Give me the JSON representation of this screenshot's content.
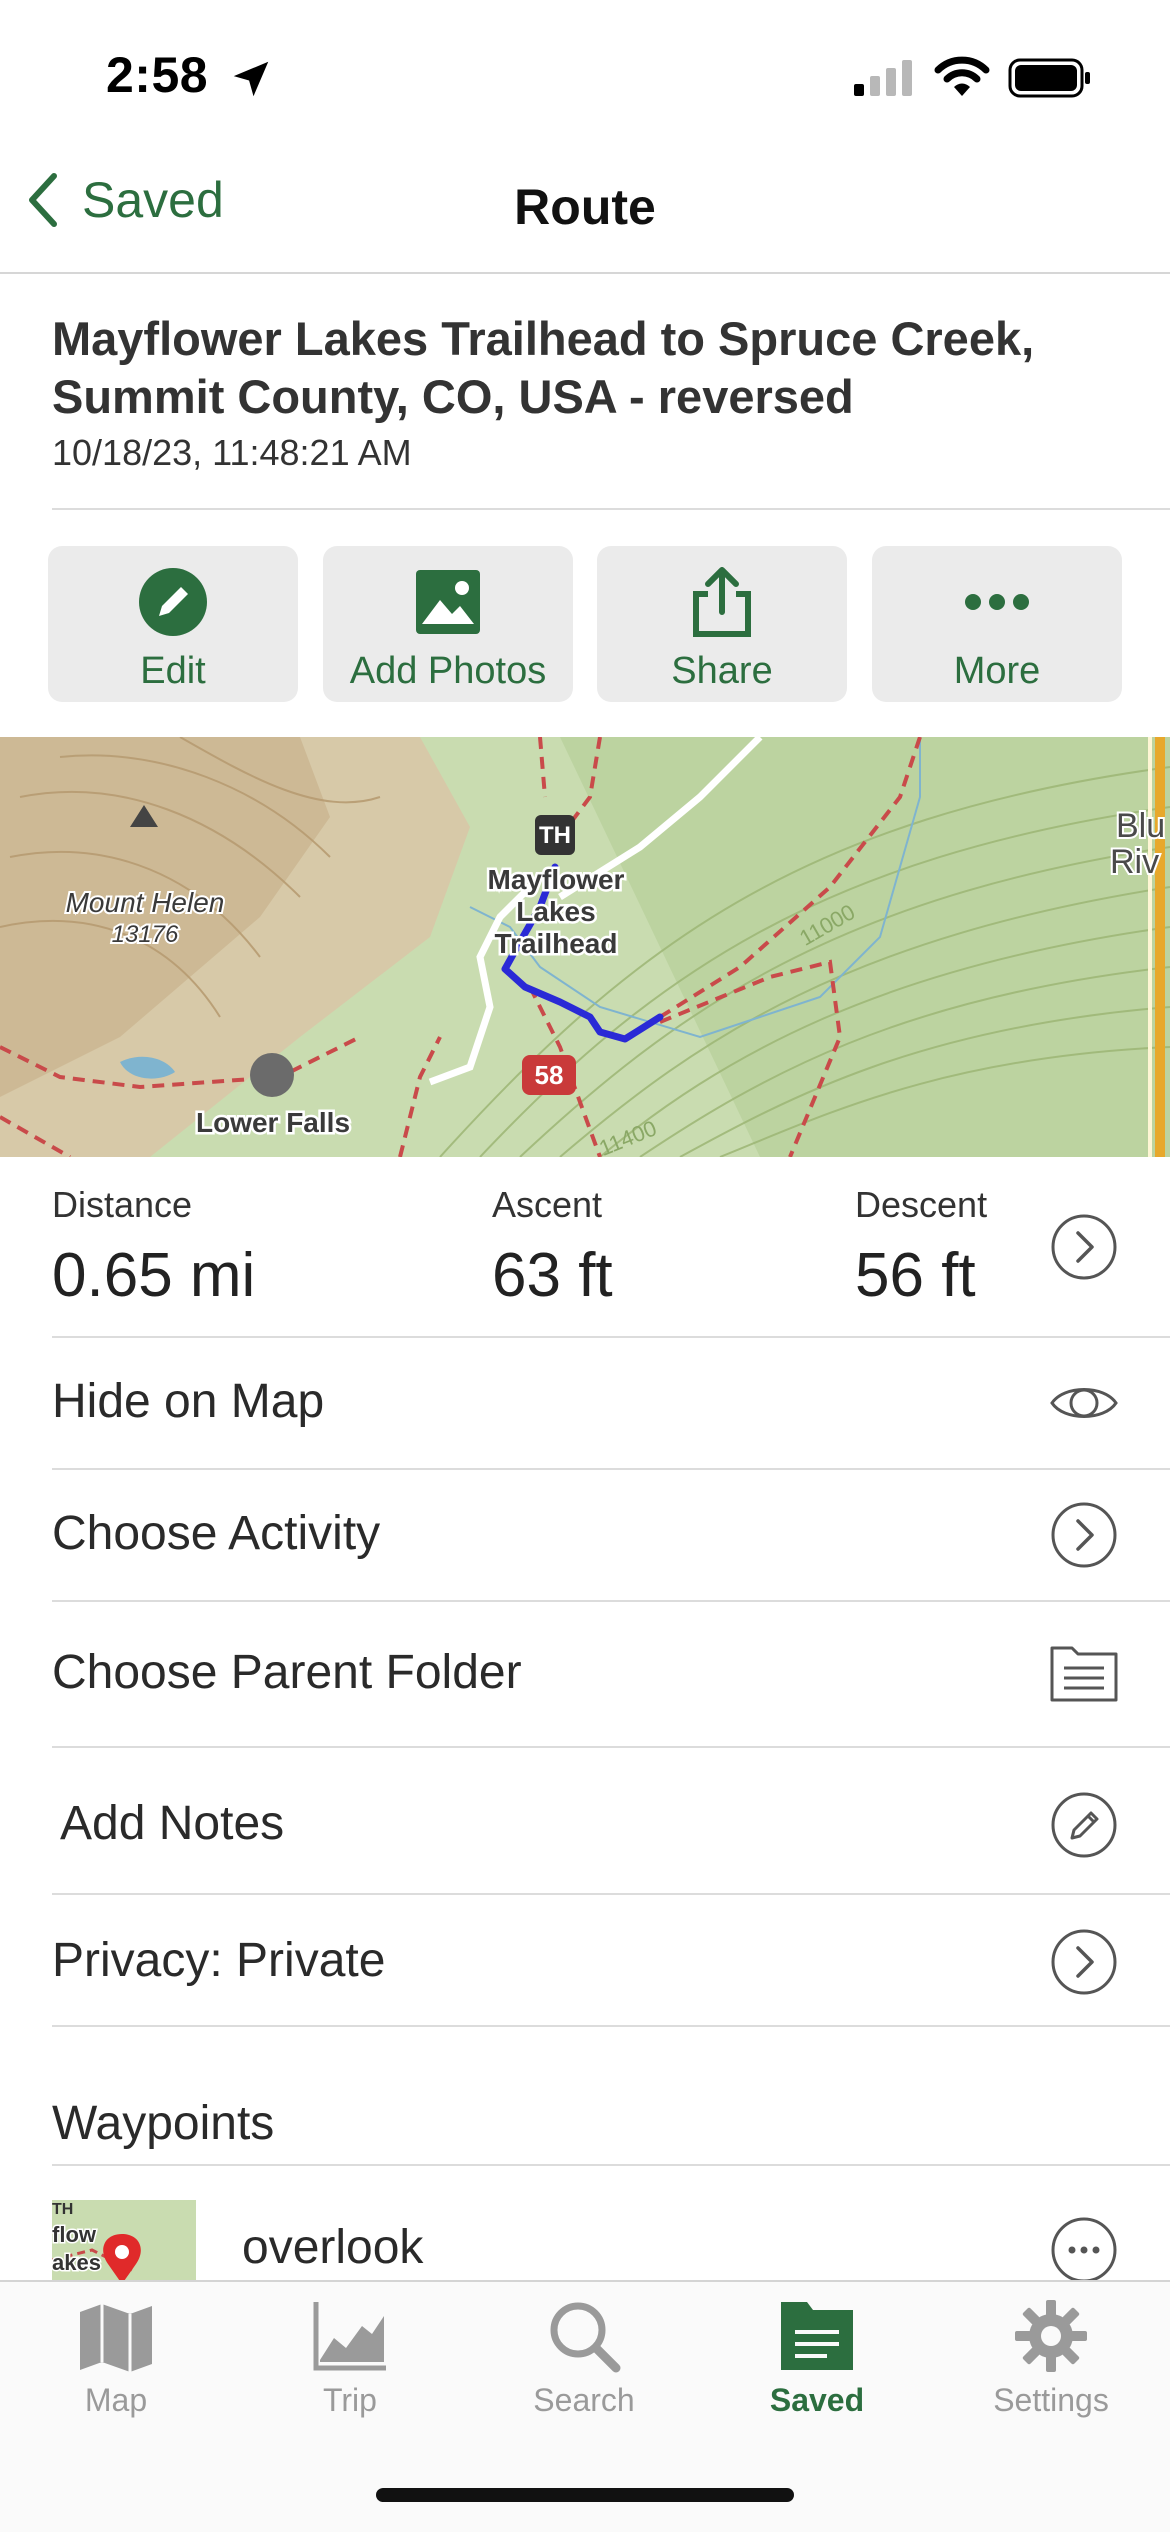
{
  "status_bar": {
    "time": "2:58"
  },
  "nav": {
    "back_label": "Saved",
    "title": "Route"
  },
  "route": {
    "title": "Mayflower Lakes Trailhead to Spruce Creek, Summit County, CO, USA - reversed",
    "date": "10/18/23, 11:48:21 AM"
  },
  "actions": [
    {
      "label": "Edit",
      "icon": "pencil-icon"
    },
    {
      "label": "Add Photos",
      "icon": "photo-icon"
    },
    {
      "label": "Share",
      "icon": "share-icon"
    },
    {
      "label": "More",
      "icon": "more-icon"
    }
  ],
  "map": {
    "labels": {
      "peak_name": "Mount Helen",
      "peak_elev": "13176",
      "trailhead_line1": "Mayflower",
      "trailhead_line2": "Lakes",
      "trailhead_line3": "Trailhead",
      "falls": "Lower Falls",
      "road_shield": "58",
      "th_marker": "TH",
      "contour_a": "11000",
      "contour_b": "11400",
      "edge_label_1": "Blu",
      "edge_label_2": "Riv"
    },
    "colors": {
      "terrain": "#c9dcb0",
      "route": "#2a2ad6",
      "trail": "#c94a4a"
    }
  },
  "stats": {
    "distance_label": "Distance",
    "distance_value": "0.65 mi",
    "ascent_label": "Ascent",
    "ascent_value": "63 ft",
    "descent_label": "Descent",
    "descent_value": "56 ft"
  },
  "rows": [
    {
      "label": "Hide on Map",
      "icon": "eye-icon"
    },
    {
      "label": "Choose Activity",
      "icon": "chevron-right-icon"
    },
    {
      "label": "Choose Parent Folder",
      "icon": "folder-icon"
    },
    {
      "label": "Add Notes",
      "icon": "pencil-circle-icon"
    },
    {
      "label": "Privacy: Private",
      "icon": "chevron-right-icon"
    }
  ],
  "waypoints": {
    "section_title": "Waypoints",
    "items": [
      {
        "name": "overlook",
        "thumb_text_1": "TH",
        "thumb_text_2": "flow",
        "thumb_text_3": "akes"
      }
    ]
  },
  "tabs": [
    {
      "label": "Map",
      "icon": "map-icon",
      "active": false
    },
    {
      "label": "Trip",
      "icon": "trip-icon",
      "active": false
    },
    {
      "label": "Search",
      "icon": "search-icon",
      "active": false
    },
    {
      "label": "Saved",
      "icon": "saved-icon",
      "active": true
    },
    {
      "label": "Settings",
      "icon": "gear-icon",
      "active": false
    }
  ],
  "theme": {
    "accent": "#2c6e3f",
    "inactive": "#9a9a9a"
  }
}
